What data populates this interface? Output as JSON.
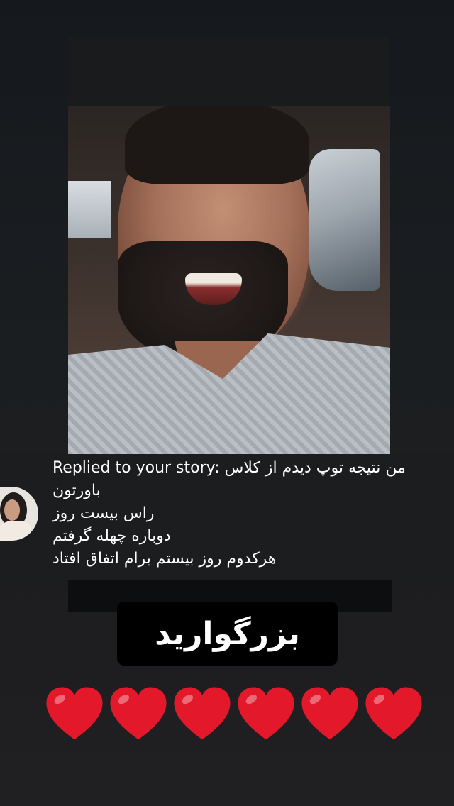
{
  "reply": {
    "prefix": "Replied to your story:",
    "line1": "من نتیجه توپ دیدم از کلاس",
    "line2": "باورتون",
    "line3": "راس بیست روز",
    "line4": "دوباره چهله گرفتم",
    "line5": "هرکدوم روز بیستم برام اتفاق افتاد"
  },
  "caption": "بزرگوارید",
  "hearts": {
    "count": 6,
    "color": "#e3192b",
    "icon": "red-heart-icon"
  },
  "colors": {
    "background": "#1b1e21",
    "reply_band": "#1c1d1f",
    "caption_bg": "#000000"
  }
}
